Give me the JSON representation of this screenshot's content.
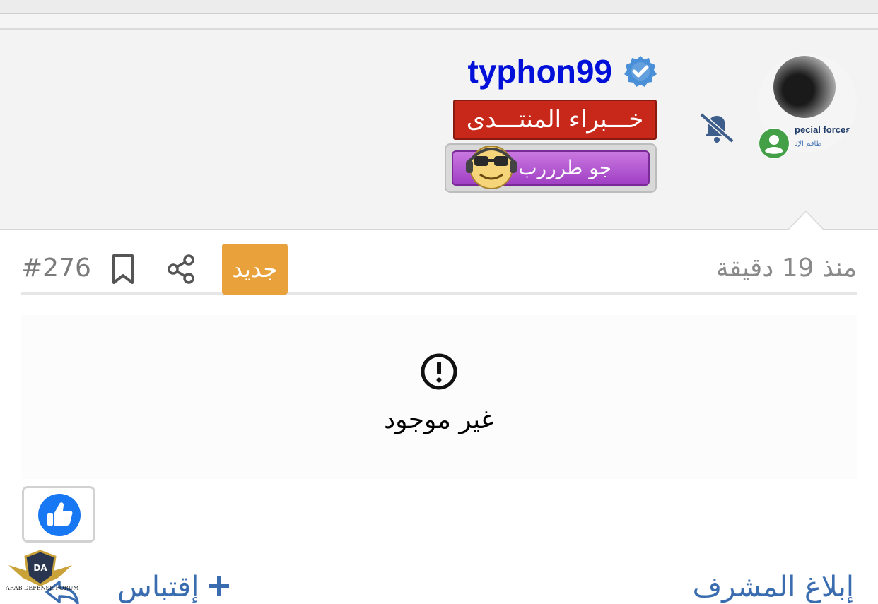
{
  "user": {
    "username": "typhon99",
    "rank": "خـــبراء المنتـــدى",
    "banner_text": "جو طرررب",
    "avatar_caption": "pecial forces",
    "avatar_sub": "طاقم الإد"
  },
  "post": {
    "time": "منذ 19 دقيقة",
    "new_badge": "جديد",
    "number": "#276",
    "content": "غير موجود"
  },
  "actions": {
    "report": "إبلاغ المشرف",
    "quote": "إقتباس"
  },
  "logo": {
    "text": "ARAB DEFENSE FORUM"
  },
  "colors": {
    "username": "#0010d8",
    "rank_bg": "#c8281a",
    "new_badge_bg": "#e9a23b",
    "link": "#3a6db0",
    "online": "#43a047",
    "verified": "#4a90d9",
    "like": "#1877f2"
  }
}
